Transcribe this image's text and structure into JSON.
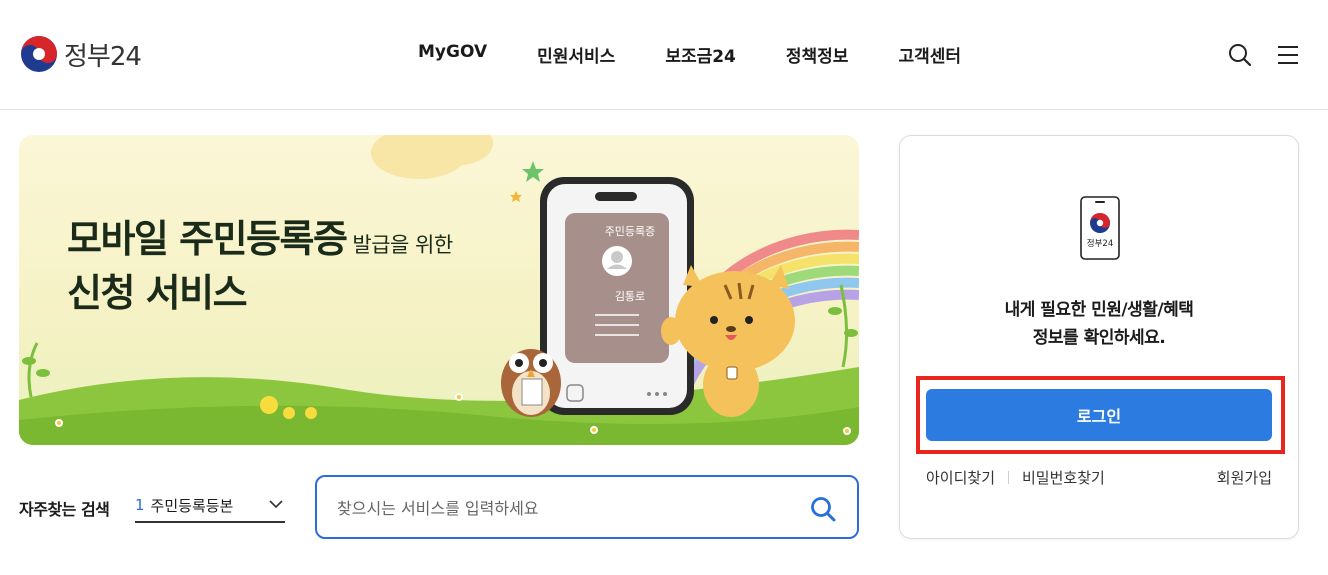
{
  "header": {
    "logo_text": "정부24",
    "nav": [
      "MyGOV",
      "민원서비스",
      "보조금24",
      "정책정보",
      "고객센터"
    ],
    "icons": [
      "search-icon",
      "hamburger-menu-icon"
    ]
  },
  "banner": {
    "title_line1": "모바일 주민등록증",
    "title_line1_small": "발급을 위한",
    "title_line2": "신청 서비스",
    "card_label": "주민등록증",
    "card_name": "김통로"
  },
  "frequent_search": {
    "label": "자주찾는 검색",
    "rank": "1",
    "selected": "주민등록등본"
  },
  "search": {
    "placeholder": "찾으시는 서비스를 입력하세요"
  },
  "login_panel": {
    "logo_text": "정부24",
    "message_line1": "내게 필요한 민원/생활/혜택",
    "message_line2": "정보를 확인하세요.",
    "login_button": "로그인",
    "find_id": "아이디찾기",
    "find_password": "비밀번호찾기",
    "signup": "회원가입"
  },
  "colors": {
    "accent_blue": "#2b7be0",
    "highlight_red": "#e8261e"
  }
}
